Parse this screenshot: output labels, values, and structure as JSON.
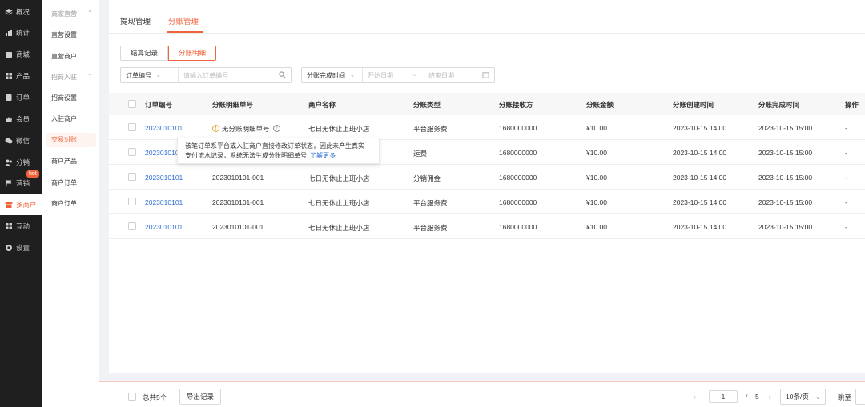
{
  "nav": {
    "items": [
      {
        "label": "概况",
        "icon": "layers-icon"
      },
      {
        "label": "统计",
        "icon": "chart-icon"
      },
      {
        "label": "商城",
        "icon": "shop-icon"
      },
      {
        "label": "产品",
        "icon": "product-icon"
      },
      {
        "label": "订单",
        "icon": "order-icon"
      },
      {
        "label": "会员",
        "icon": "crown-icon"
      },
      {
        "label": "微信",
        "icon": "wechat-icon"
      },
      {
        "label": "分销",
        "icon": "distribution-icon"
      },
      {
        "label": "营销",
        "icon": "flag-icon"
      },
      {
        "label": "多商户",
        "icon": "store-icon"
      },
      {
        "label": "互动",
        "icon": "grid-icon"
      },
      {
        "label": "设置",
        "icon": "gear-icon"
      }
    ],
    "hot_badge": "hot"
  },
  "subnav": {
    "group1": "商家直营",
    "group1_items": [
      "直营设置",
      "直营商户"
    ],
    "group2": "招商入驻",
    "group2_items": [
      "招商设置",
      "入驻商户",
      "交易对账",
      "商户产品",
      "商户订单",
      "商户订单"
    ]
  },
  "tabs": [
    "提现管理",
    "分账管理"
  ],
  "segments": [
    "结算记录",
    "分账明细"
  ],
  "filters": {
    "order_select": "订单编号",
    "order_placeholder": "请输入订单编号",
    "time_select": "分账完成时间",
    "start_placeholder": "开始日期",
    "range_sep": "~",
    "end_placeholder": "结束日期"
  },
  "table": {
    "columns": [
      "订单编号",
      "分账明细单号",
      "商户名称",
      "分账类型",
      "分账接收方",
      "分账金额",
      "分账创建时间",
      "分账完成时间",
      "操作"
    ],
    "rows": [
      {
        "order": "2023010101",
        "detail": "无分账明细单号",
        "merchant": "七日无休止上班小店",
        "type": "平台服务费",
        "receiver": "1680000000",
        "amount": "¥10.00",
        "created": "2023-10-15  14:00",
        "finished": "2023-10-15  15:00",
        "op": "-"
      },
      {
        "order": "2023010101",
        "detail": "",
        "merchant": "",
        "type": "运费",
        "receiver": "1680000000",
        "amount": "¥10.00",
        "created": "2023-10-15  14:00",
        "finished": "2023-10-15  15:00",
        "op": "-"
      },
      {
        "order": "2023010101",
        "detail": "2023010101-001",
        "merchant": "七日无休止上班小店",
        "type": "分销佣金",
        "receiver": "1680000000",
        "amount": "¥10.00",
        "created": "2023-10-15  14:00",
        "finished": "2023-10-15  15:00",
        "op": "-"
      },
      {
        "order": "2023010101",
        "detail": "2023010101-001",
        "merchant": "七日无休止上班小店",
        "type": "平台服务费",
        "receiver": "1680000000",
        "amount": "¥10.00",
        "created": "2023-10-15  14:00",
        "finished": "2023-10-15  15:00",
        "op": "-"
      },
      {
        "order": "2023010101",
        "detail": "2023010101-001",
        "merchant": "七日无休止上班小店",
        "type": "平台服务费",
        "receiver": "1680000000",
        "amount": "¥10.00",
        "created": "2023-10-15  14:00",
        "finished": "2023-10-15  15:00",
        "op": "-"
      }
    ]
  },
  "tooltip": {
    "line1": "该笔订单系平台或入驻商户直接修改订单状态，因此未产生真实",
    "line2": "支付流水记录，系统无法生成分账明细单号",
    "more": "了解更多"
  },
  "footer": {
    "total": "总共5个",
    "export": "导出记录",
    "page": "1",
    "page_sep": "/",
    "page_total": "5",
    "page_size": "10条/页",
    "jump": "跳至"
  },
  "colors": {
    "accent": "#f0643c",
    "link": "#2f6fd6",
    "nav_bg": "#1f1f1f"
  }
}
